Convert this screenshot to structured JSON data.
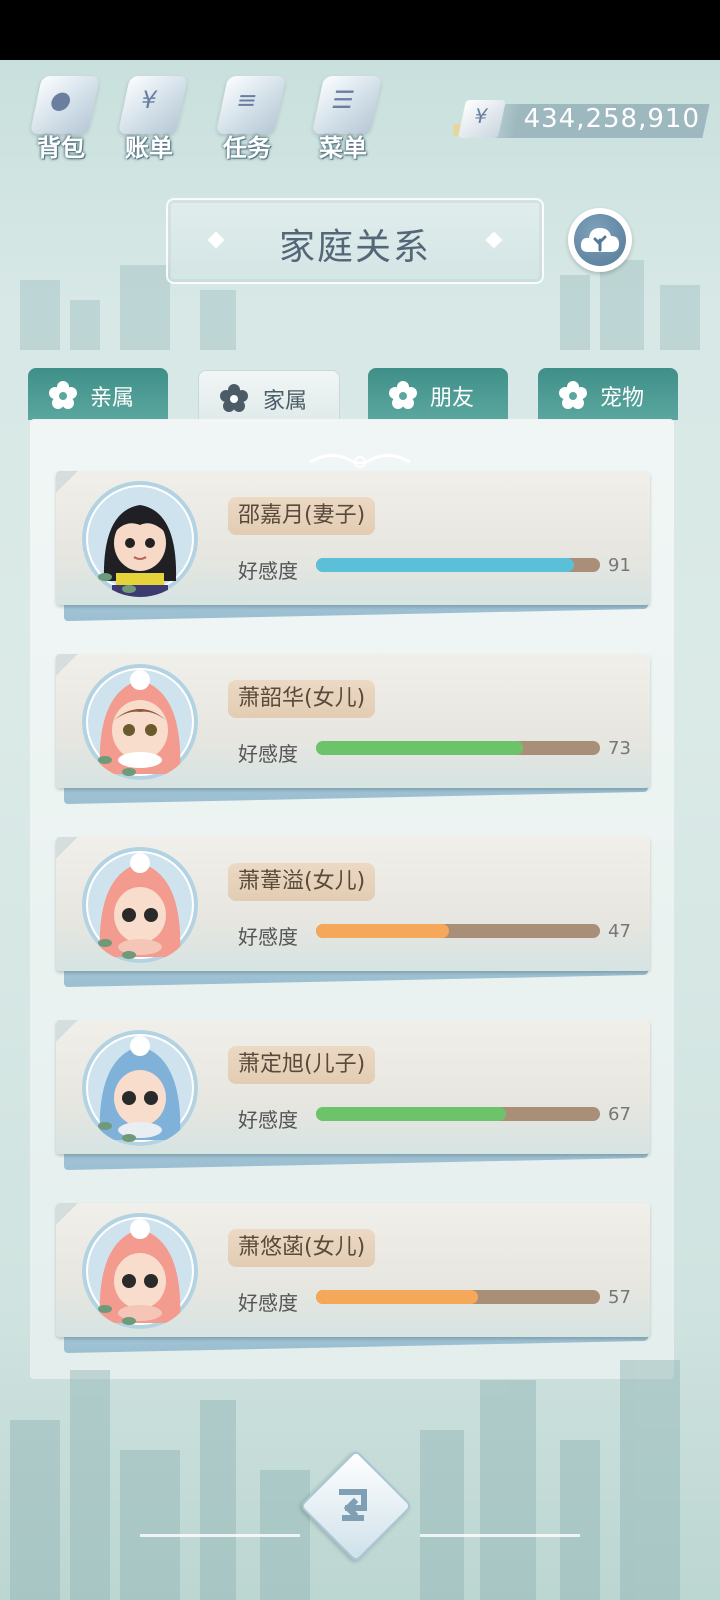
{
  "topbar": {
    "buttons": [
      {
        "label": "背包",
        "icon": "backpack-icon"
      },
      {
        "label": "账单",
        "icon": "bill-icon"
      },
      {
        "label": "任务",
        "icon": "task-icon"
      },
      {
        "label": "菜单",
        "icon": "menu-icon"
      }
    ],
    "currency": {
      "symbol": "¥",
      "value": "434,258,910"
    }
  },
  "title": "家庭关系",
  "cloud_button": {
    "icon": "cloud-tree-icon"
  },
  "tabs": [
    {
      "label": "亲属",
      "active": false
    },
    {
      "label": "家属",
      "active": true
    },
    {
      "label": "朋友",
      "active": false
    },
    {
      "label": "宠物",
      "active": false
    }
  ],
  "favor_label": "好感度",
  "members": [
    {
      "name": "邵嘉月(妻子)",
      "favor": 91,
      "bar_color": "#5bbfd8",
      "avatar": "black-hair-avatar"
    },
    {
      "name": "萧韶华(女儿)",
      "favor": 73,
      "bar_color": "#6cc36a",
      "avatar": "pink-hood-avatar"
    },
    {
      "name": "萧葦溢(女儿)",
      "favor": 47,
      "bar_color": "#f5a85a",
      "avatar": "pink-hood-avatar"
    },
    {
      "name": "萧定旭(儿子)",
      "favor": 67,
      "bar_color": "#6cc36a",
      "avatar": "blue-hood-avatar"
    },
    {
      "name": "萧悠菡(女儿)",
      "favor": 57,
      "bar_color": "#f5a85a",
      "avatar": "pink-hood-avatar"
    }
  ],
  "back_button": {
    "icon": "back-arrow-icon"
  }
}
